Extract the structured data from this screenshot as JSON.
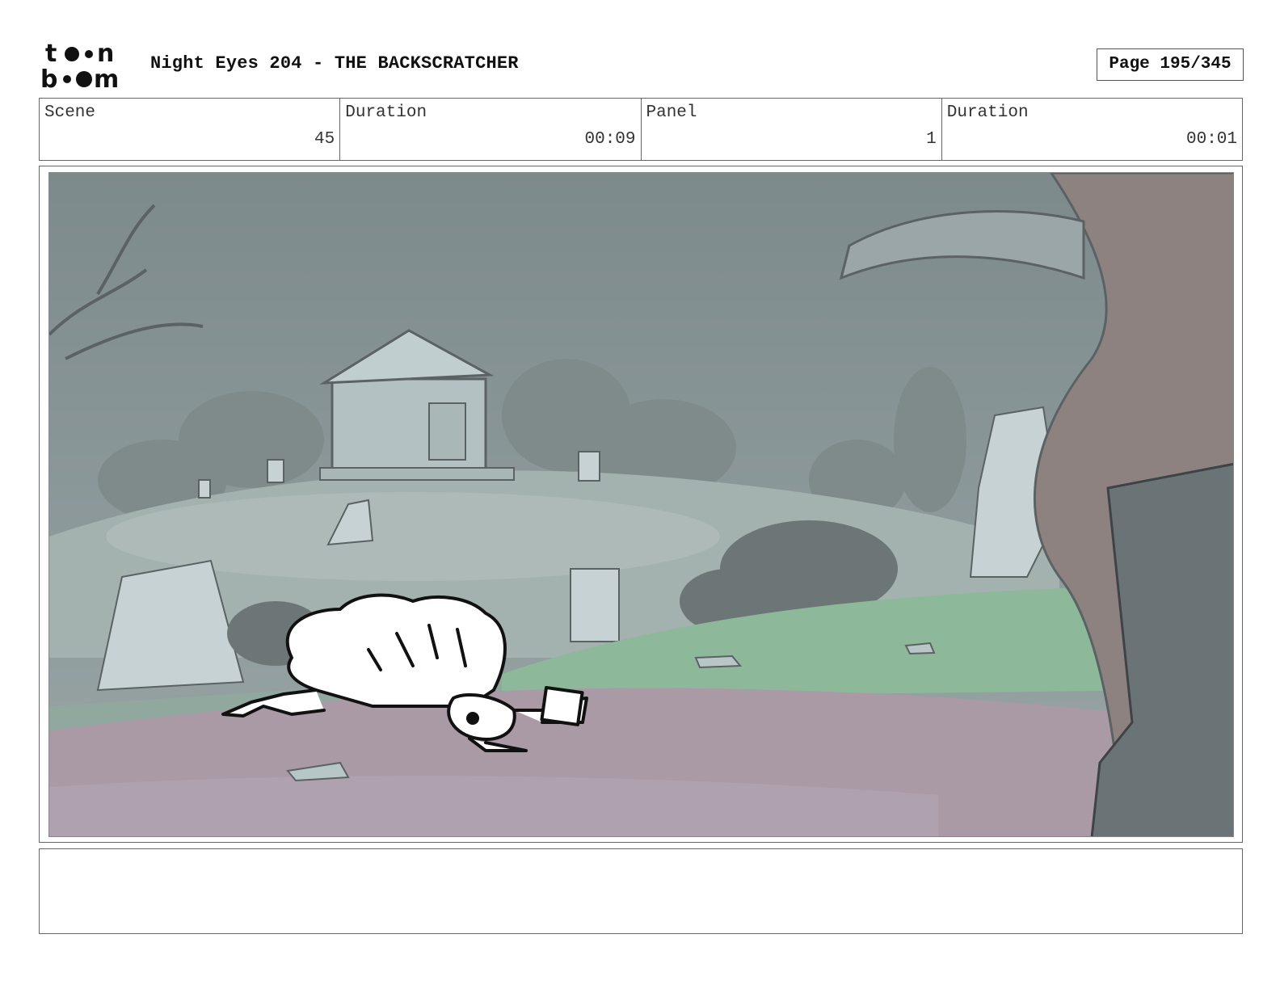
{
  "logo": {
    "name": "toonboom-logo",
    "line1": "toon",
    "line2": "boom"
  },
  "header": {
    "title": "Night Eyes 204 - THE BACKSCRATCHER",
    "page": "Page 195/345"
  },
  "info": {
    "scene_label": "Scene",
    "scene_value": "45",
    "scene_duration_label": "Duration",
    "scene_duration_value": "00:09",
    "panel_label": "Panel",
    "panel_value": "1",
    "panel_duration_label": "Duration",
    "panel_duration_value": "00:01"
  },
  "panel": {
    "image": "graveyard-scene-character-crawling-holding-card"
  },
  "notes": {
    "text": ""
  }
}
